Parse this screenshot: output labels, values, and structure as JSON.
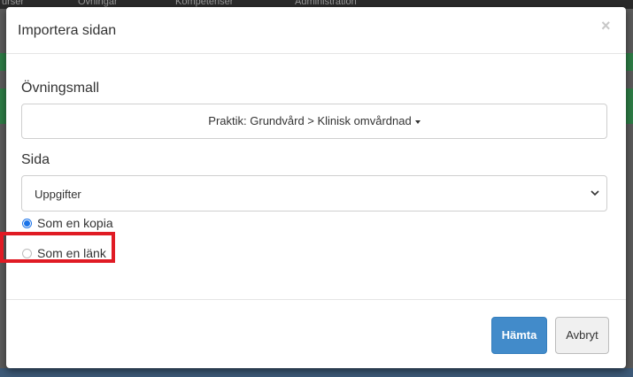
{
  "background": {
    "nav_items": [
      "urser",
      "Övningar",
      "Kompetenser",
      "Administration"
    ]
  },
  "modal": {
    "title": "Importera sidan",
    "close_label": "×",
    "template_label": "Övningsmall",
    "template_value": "Praktik: Grundvård > Klinisk omvårdnad",
    "page_label": "Sida",
    "page_value": "Uppgifter",
    "options": [
      {
        "label": "Som en kopia",
        "checked": true
      },
      {
        "label": "Som en länk",
        "checked": false
      }
    ],
    "fetch_button": "Hämta",
    "cancel_button": "Avbryt"
  },
  "colors": {
    "primary": "#428bca",
    "highlight": "#e01b24",
    "radio_accent": "#1a73e8"
  }
}
